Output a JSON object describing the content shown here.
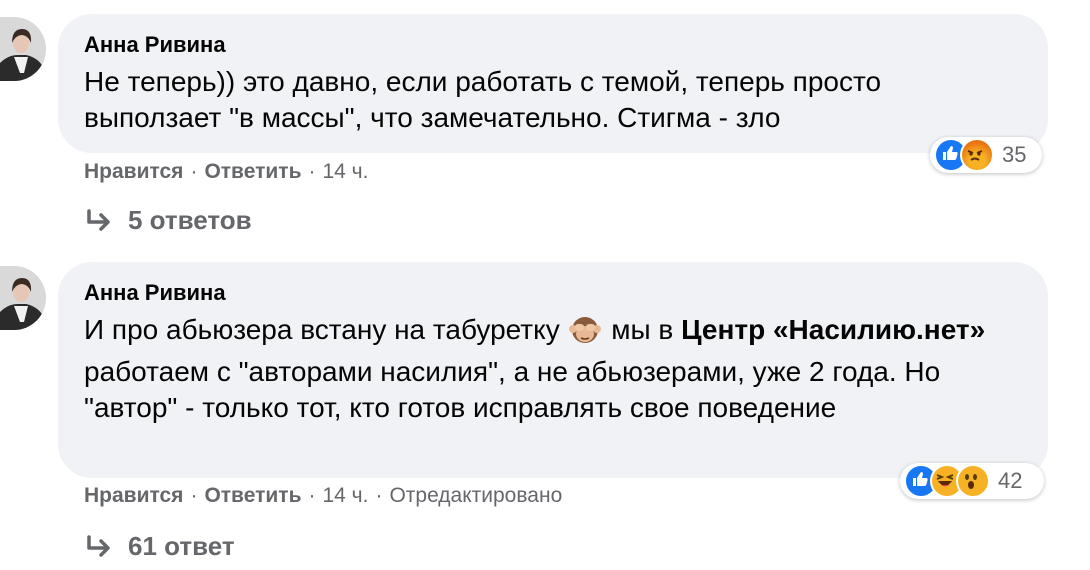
{
  "comments": [
    {
      "author": "Анна Ривина",
      "text": "Не теперь)) это давно, если работать с темой, теперь просто выползает \"в массы\", что замечательно. Стигма - зло",
      "like_label": "Нравится",
      "reply_label": "Ответить",
      "time": "14 ч.",
      "reaction_count": "35",
      "reactions": [
        "like-icon",
        "angry-icon"
      ],
      "replies_label": "5 ответов"
    },
    {
      "author": "Анна Ривина",
      "text_part1": "И про абьюзера встану на табуретку",
      "emoji": "see-no-evil-monkey-icon",
      "text_part2": " мы в ",
      "text_bold": "Центр «Насилию.нет»",
      "text_part3": " работаем с \"авторами насилия\", а не абьюзерами, уже 2 года. Но \"автор\" - только тот, кто готов исправлять свое поведение",
      "like_label": "Нравится",
      "reply_label": "Ответить",
      "time": "14 ч.",
      "edited_label": "Отредактировано",
      "reaction_count": "42",
      "reactions": [
        "like-icon",
        "haha-icon",
        "wow-icon"
      ],
      "replies_label": "61 ответ"
    }
  ],
  "colors": {
    "bubble": "#f0f2f5",
    "meta_text": "#65676b",
    "like_blue": "#1877f2",
    "emoji_yellow": "#f7b125",
    "angry_orange": "#e9710f"
  }
}
